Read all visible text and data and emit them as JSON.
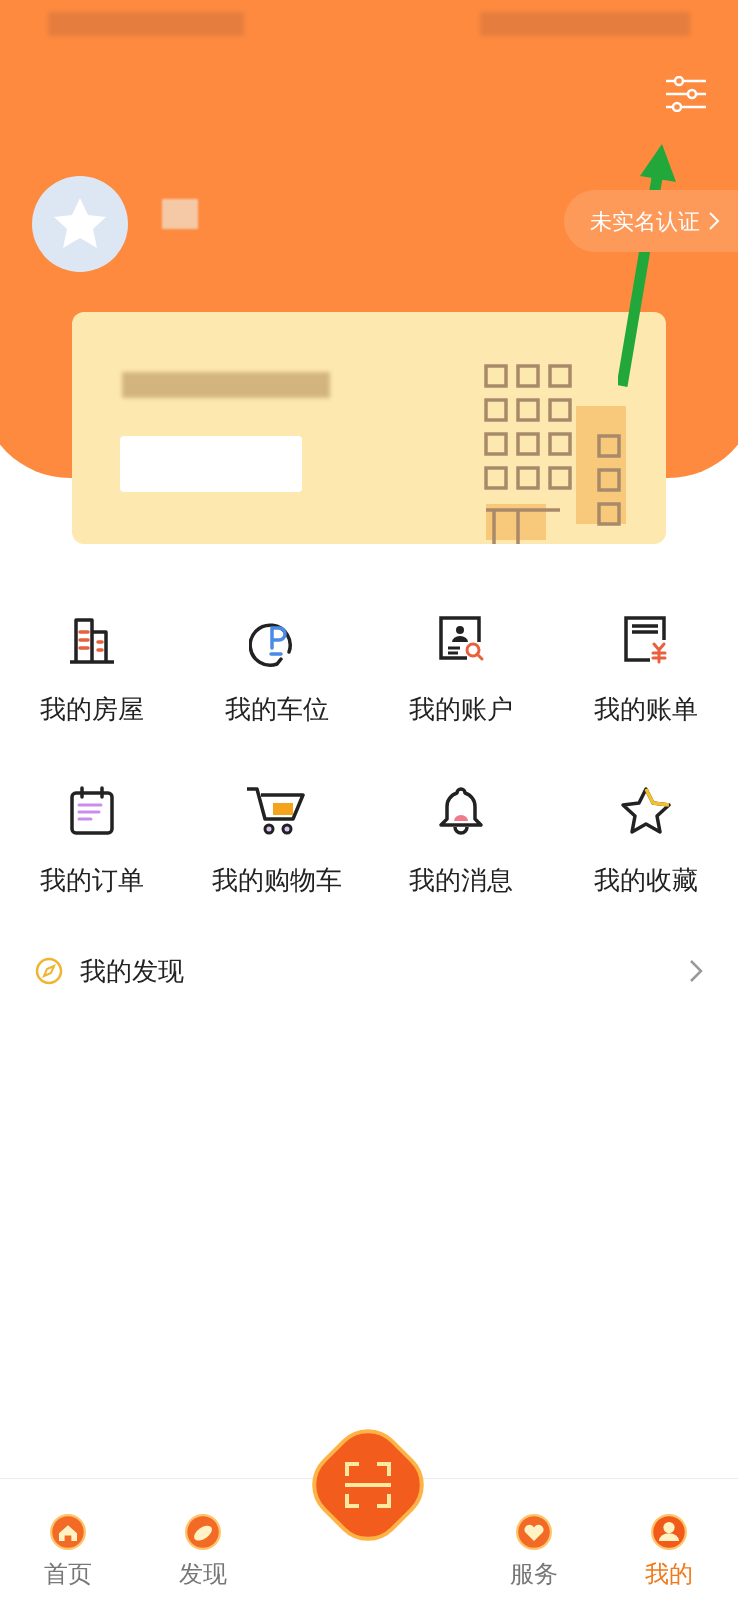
{
  "profile": {
    "verify_label": "未实名认证"
  },
  "services": [
    {
      "label": "我的房屋"
    },
    {
      "label": "我的车位"
    },
    {
      "label": "我的账户"
    },
    {
      "label": "我的账单"
    },
    {
      "label": "我的订单"
    },
    {
      "label": "我的购物车"
    },
    {
      "label": "我的消息"
    },
    {
      "label": "我的收藏"
    }
  ],
  "discover_row": {
    "label": "我的发现"
  },
  "tab_bar": [
    {
      "label": "首页",
      "selected": false
    },
    {
      "label": "发现",
      "selected": false
    },
    {
      "kind": "scan"
    },
    {
      "label": "服务",
      "selected": false
    },
    {
      "label": "我的",
      "selected": true
    }
  ]
}
